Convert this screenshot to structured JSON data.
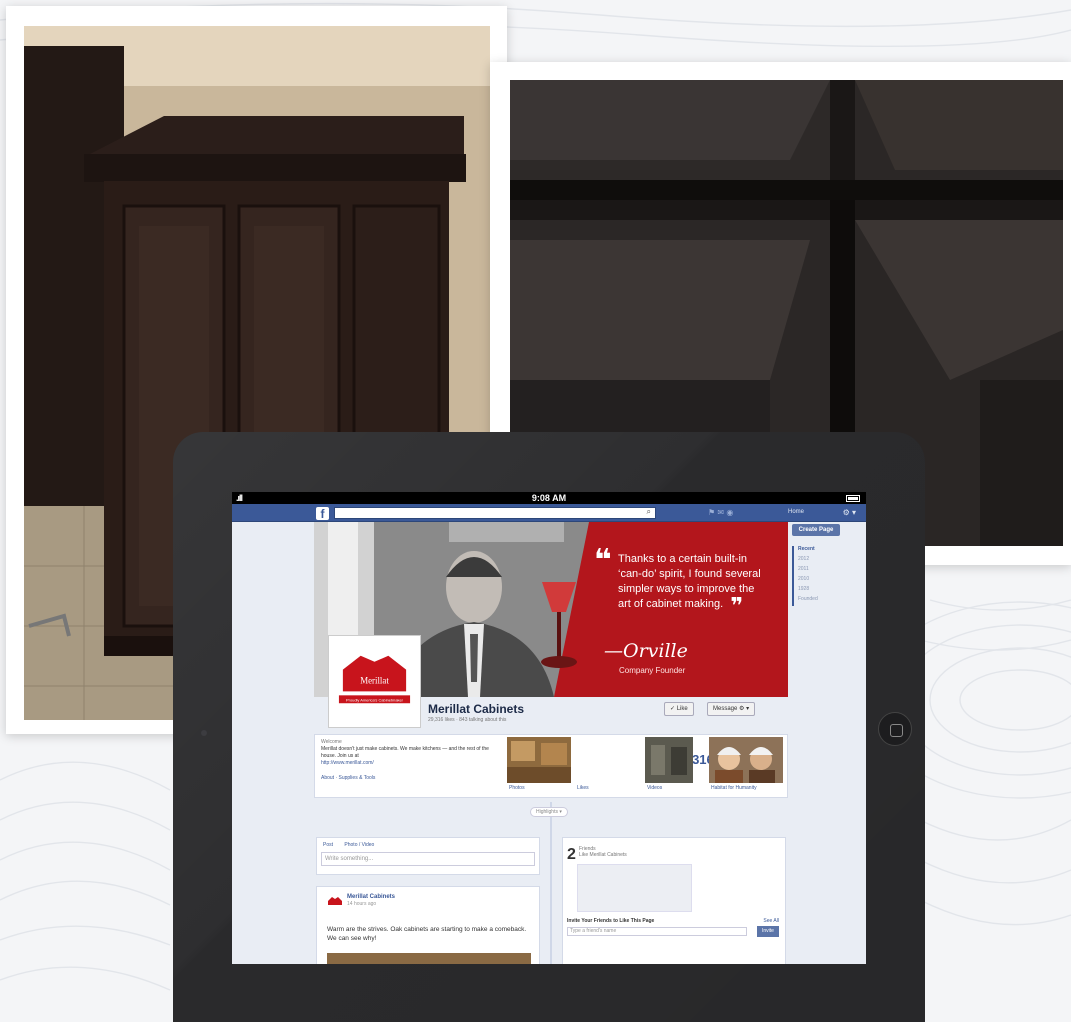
{
  "statusbar": {
    "signal": ".ıll",
    "time": "9:08 AM"
  },
  "fb": {
    "logo": "f",
    "search_value": "",
    "search_icon": "magnifier-icon",
    "home_label": "Home",
    "create_page": "Create Page",
    "rail_items": [
      "Recent",
      "2012",
      "2011",
      "2010",
      "1928",
      "Founded"
    ]
  },
  "cover": {
    "quote": "Thanks to a certain built-in ‘can-do’ spirit, I found several simpler ways to improve the art of cabinet making.",
    "quote_open": "❝",
    "quote_close": "❞",
    "signature": "—Orville",
    "signature_title": "Company Founder"
  },
  "profile": {
    "logo_text": "Merillat",
    "tagline": "Proudly America's Cabinetmaker",
    "name": "Merillat Cabinets",
    "stats": "29,316 likes · 843 talking about this"
  },
  "buttons": {
    "like": "✓ Like",
    "message": "Message",
    "gear": "⚙ ▾"
  },
  "about": {
    "heading": "Welcome",
    "text": "Merillat doesn't just make cabinets. We make kitchens — and the rest of the house. Join us at",
    "link": "http://www.merillat.com/",
    "category": "About · Supplies & Tools"
  },
  "tiles": {
    "photos_label": "Photos",
    "likes_label": "Likes",
    "likes_count": "29,316",
    "videos_label": "Videos",
    "habitat_label": "Habitat for Humanity"
  },
  "timeline": {
    "highlights": "Highlights ▾"
  },
  "composer": {
    "status_tab": "Post",
    "photo_tab": "Photo / Video",
    "placeholder": "Write something..."
  },
  "post": {
    "author": "Merillat Cabinets",
    "time": "14 hours ago",
    "text": "Warm are the strives. Oak cabinets are starting to make a comeback. We can see why!"
  },
  "friends": {
    "count": "2",
    "line1": "Friends",
    "line2": "Like Merillat Cabinets",
    "invite_title": "Invite Your Friends to Like This Page",
    "see_all": "See All",
    "invite_placeholder": "Type a friend's name",
    "invite_button": "Invite"
  }
}
